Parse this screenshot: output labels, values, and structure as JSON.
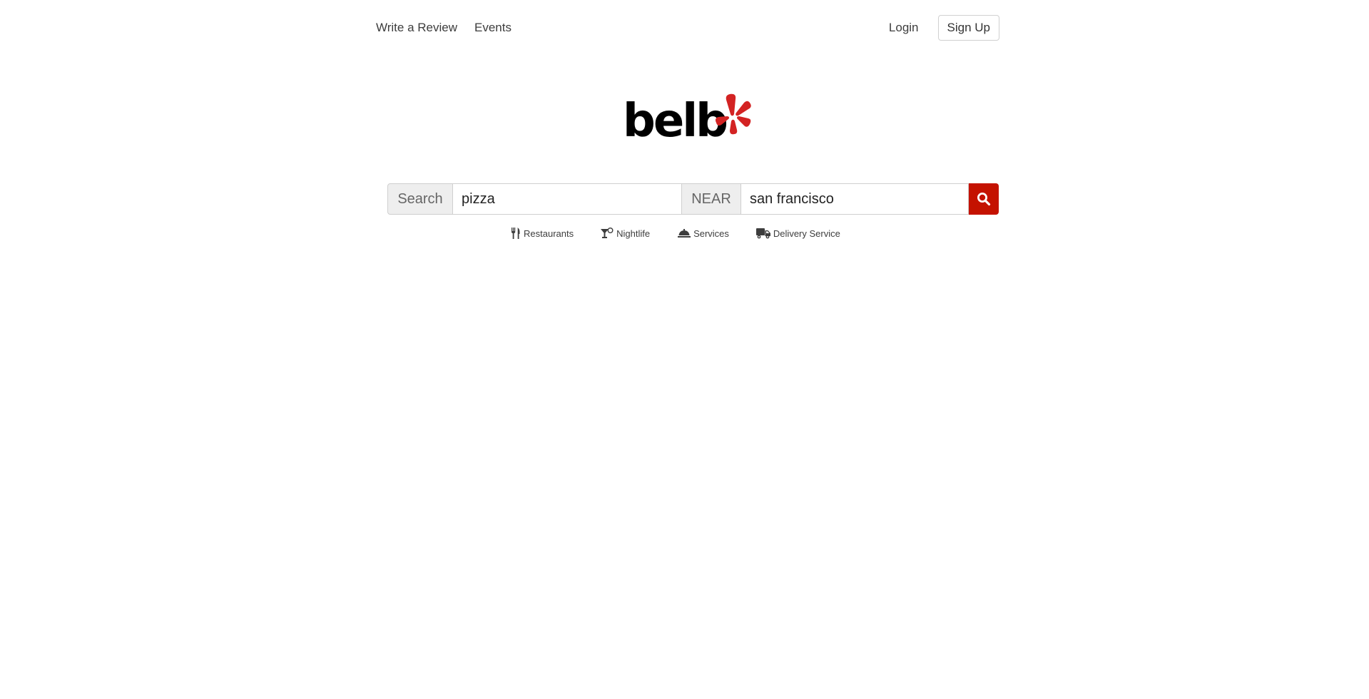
{
  "nav": {
    "write_review": "Write a Review",
    "events": "Events",
    "login": "Login",
    "signup": "Sign Up"
  },
  "logo": {
    "text": "belb",
    "burst_color": "#d32323"
  },
  "search": {
    "search_label": "Search",
    "query_value": "pizza",
    "near_label": "NEAR",
    "location_value": "san francisco",
    "button_icon": "search-icon",
    "button_color": "#c41200"
  },
  "categories": [
    {
      "label": "Restaurants",
      "icon": "fork-knife-icon"
    },
    {
      "label": "Nightlife",
      "icon": "cocktail-icon"
    },
    {
      "label": "Services",
      "icon": "bell-icon"
    },
    {
      "label": "Delivery Service",
      "icon": "truck-icon"
    }
  ]
}
